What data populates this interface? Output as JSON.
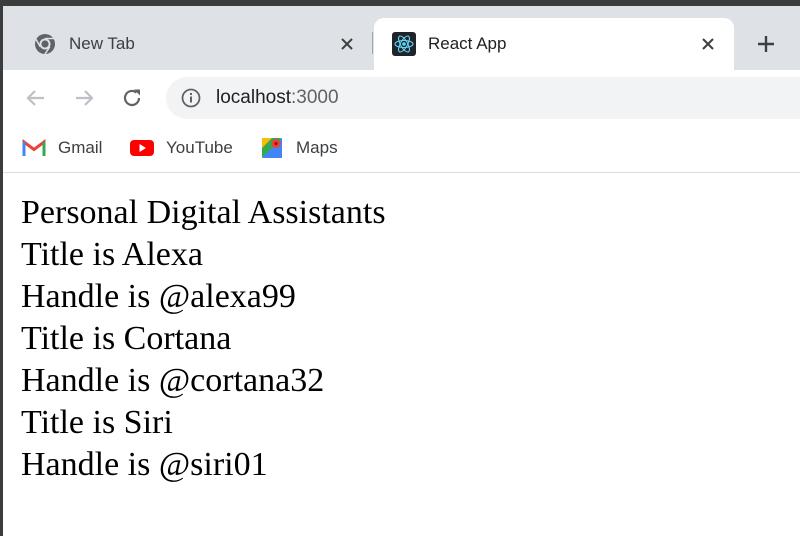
{
  "tabs": [
    {
      "title": "New Tab",
      "favicon": "chrome-icon",
      "active": false
    },
    {
      "title": "React App",
      "favicon": "react-icon",
      "active": true
    }
  ],
  "toolbar": {
    "url_host": "localhost",
    "url_port": ":3000"
  },
  "bookmarks": [
    {
      "label": "Gmail",
      "icon": "gmail-icon"
    },
    {
      "label": "YouTube",
      "icon": "youtube-icon"
    },
    {
      "label": "Maps",
      "icon": "maps-icon"
    }
  ],
  "page": {
    "heading": "Personal Digital Assistants",
    "assistants": [
      {
        "title_line": "Title is Alexa",
        "handle_line": "Handle is @alexa99"
      },
      {
        "title_line": "Title is Cortana",
        "handle_line": "Handle is @cortana32"
      },
      {
        "title_line": "Title is Siri",
        "handle_line": "Handle is @siri01"
      }
    ]
  },
  "colors": {
    "tabstrip": "#dee1e6",
    "omnibox": "#f1f3f4",
    "react_blue": "#61dafb",
    "youtube_red": "#ff0000"
  }
}
